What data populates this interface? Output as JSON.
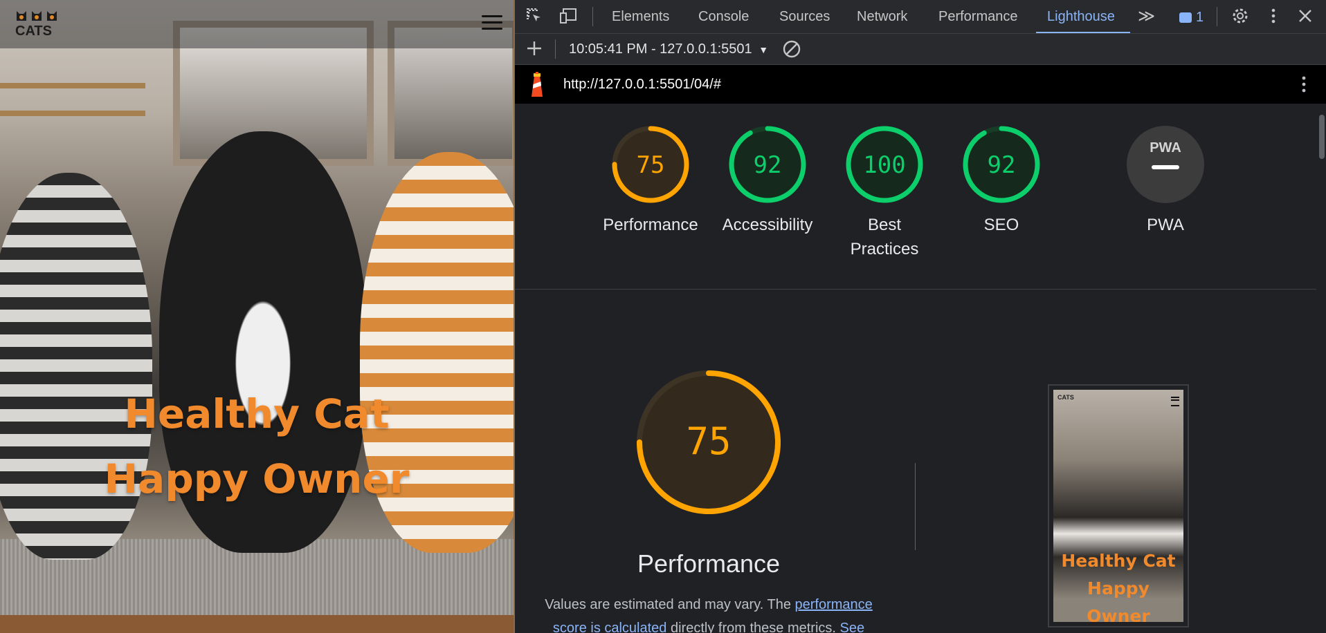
{
  "page": {
    "logo_text": "CATS",
    "hero_line1": "Healthy Cat",
    "hero_line2": "Happy Owner"
  },
  "devtools": {
    "tabs": [
      {
        "label": "Elements"
      },
      {
        "label": "Console"
      },
      {
        "label": "Sources"
      },
      {
        "label": "Network"
      },
      {
        "label": "Performance"
      },
      {
        "label": "Lighthouse",
        "active": true
      }
    ],
    "more_tabs_glyph": "≫",
    "message_count": "1",
    "report_selector": "10:05:41 PM - 127.0.0.1:5501",
    "url": "http://127.0.0.1:5501/04/#",
    "scores": [
      {
        "label": "Performance",
        "score": 75,
        "color": "#ffa400",
        "track": "#3d3426",
        "fill": "#33291c"
      },
      {
        "label": "Accessibility",
        "score": 92,
        "color": "#0cce6b",
        "track": "#173d26",
        "fill": "#152a1d"
      },
      {
        "label": "Best Practices",
        "score": 100,
        "color": "#0cce6b",
        "track": "#173d26",
        "fill": "#152a1d"
      },
      {
        "label": "SEO",
        "score": 92,
        "color": "#0cce6b",
        "track": "#173d26",
        "fill": "#152a1d"
      }
    ],
    "pwa": {
      "label": "PWA",
      "badge": "PWA"
    },
    "big_score": {
      "label": "Performance",
      "score": 75,
      "color": "#ffa400"
    },
    "description": {
      "prefix": "Values are estimated and may vary. The ",
      "link1": "performance score is calculated",
      "middle": " directly from these metrics. ",
      "link2": "See"
    },
    "thumbnail": {
      "logo": "CATS",
      "hero_line1": "Healthy Cat",
      "hero_line2": "Happy Owner"
    }
  }
}
